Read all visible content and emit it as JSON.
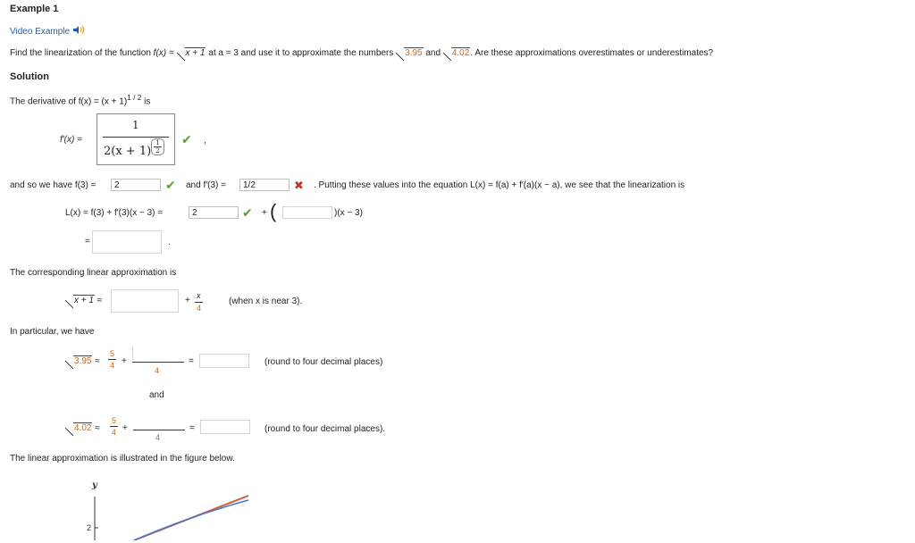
{
  "header": {
    "title": "Example 1",
    "video_link": "Video Example"
  },
  "problem": {
    "find": "Find the linearization of the function",
    "func": "f(x) =",
    "radicand": "x + 1",
    "at": "at a = 3 and use it to approximate the numbers",
    "n1": "3.95",
    "and": "and",
    "n2": "4.02",
    "question": ". Are these approximations overestimates or underestimates?"
  },
  "solution": {
    "heading": "Solution",
    "derivative_text": "The derivative of f(x) = (x + 1)",
    "derivative_exp": "1 / 2",
    "derivative_is": "is",
    "fprime_label": "f′(x) =",
    "frac_num": "1",
    "frac_den": "2(x + 1)",
    "frac_exp_num": "1",
    "frac_exp_den": "2",
    "comma": ","
  },
  "values_row": {
    "prefix": "and so we have f(3) =",
    "f3_value": "2",
    "fprime3_label": "and f′(3) =",
    "fprime3_value": "1/2",
    "suffix": ". Putting these values into the equation L(x) = f(a) + f′(a)(x − a), we see that the linearization is"
  },
  "linearization": {
    "lhs": "L(x) = f(3) + f′(3)(x − 3) =",
    "value1": "2",
    "plus": "+",
    "tail": ")(x − 3)",
    "equals": "=",
    "period": "."
  },
  "approximation": {
    "intro": "The corresponding linear approximation is",
    "radicand": "x + 1",
    "approx": "≈",
    "plus_frac_num": "x",
    "plus_frac_den": "4",
    "when": "(when x is near 3)."
  },
  "particular": {
    "intro": "In particular, we have",
    "row1": {
      "radicand": "3.95",
      "lead_num": "5",
      "lead_den": "4",
      "den": "4",
      "note": "(round to four decimal places)"
    },
    "and": "and",
    "row2": {
      "radicand": "4.02",
      "lead_num": "5",
      "lead_den": "4",
      "den": "4",
      "note": "(round to four decimal places)."
    }
  },
  "figure": {
    "intro": "The linear approximation is illustrated in the figure below.",
    "y_label": "y",
    "y_tick": "2"
  },
  "colors": {
    "link": "#1f5fa8",
    "accent": "#c46b20",
    "check": "#5aa02c",
    "cross": "#c0392b",
    "line_orange": "#c8643c",
    "line_blue": "#4a78c8"
  },
  "icons": {
    "speaker": "speaker-icon",
    "check": "check-icon",
    "cross": "cross-icon"
  }
}
